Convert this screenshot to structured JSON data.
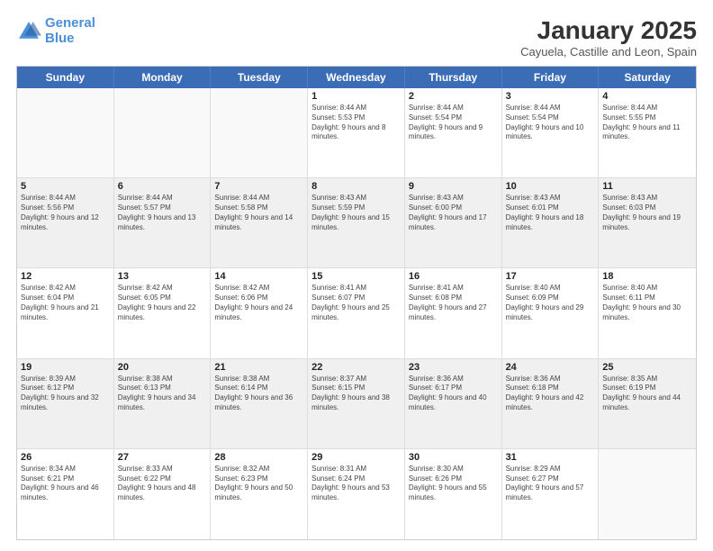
{
  "logo": {
    "line1": "General",
    "line2": "Blue"
  },
  "title": "January 2025",
  "subtitle": "Cayuela, Castille and Leon, Spain",
  "dayHeaders": [
    "Sunday",
    "Monday",
    "Tuesday",
    "Wednesday",
    "Thursday",
    "Friday",
    "Saturday"
  ],
  "rows": [
    {
      "shaded": false,
      "cells": [
        {
          "day": "",
          "info": ""
        },
        {
          "day": "",
          "info": ""
        },
        {
          "day": "",
          "info": ""
        },
        {
          "day": "1",
          "info": "Sunrise: 8:44 AM\nSunset: 5:53 PM\nDaylight: 9 hours and 8 minutes."
        },
        {
          "day": "2",
          "info": "Sunrise: 8:44 AM\nSunset: 5:54 PM\nDaylight: 9 hours and 9 minutes."
        },
        {
          "day": "3",
          "info": "Sunrise: 8:44 AM\nSunset: 5:54 PM\nDaylight: 9 hours and 10 minutes."
        },
        {
          "day": "4",
          "info": "Sunrise: 8:44 AM\nSunset: 5:55 PM\nDaylight: 9 hours and 11 minutes."
        }
      ]
    },
    {
      "shaded": true,
      "cells": [
        {
          "day": "5",
          "info": "Sunrise: 8:44 AM\nSunset: 5:56 PM\nDaylight: 9 hours and 12 minutes."
        },
        {
          "day": "6",
          "info": "Sunrise: 8:44 AM\nSunset: 5:57 PM\nDaylight: 9 hours and 13 minutes."
        },
        {
          "day": "7",
          "info": "Sunrise: 8:44 AM\nSunset: 5:58 PM\nDaylight: 9 hours and 14 minutes."
        },
        {
          "day": "8",
          "info": "Sunrise: 8:43 AM\nSunset: 5:59 PM\nDaylight: 9 hours and 15 minutes."
        },
        {
          "day": "9",
          "info": "Sunrise: 8:43 AM\nSunset: 6:00 PM\nDaylight: 9 hours and 17 minutes."
        },
        {
          "day": "10",
          "info": "Sunrise: 8:43 AM\nSunset: 6:01 PM\nDaylight: 9 hours and 18 minutes."
        },
        {
          "day": "11",
          "info": "Sunrise: 8:43 AM\nSunset: 6:03 PM\nDaylight: 9 hours and 19 minutes."
        }
      ]
    },
    {
      "shaded": false,
      "cells": [
        {
          "day": "12",
          "info": "Sunrise: 8:42 AM\nSunset: 6:04 PM\nDaylight: 9 hours and 21 minutes."
        },
        {
          "day": "13",
          "info": "Sunrise: 8:42 AM\nSunset: 6:05 PM\nDaylight: 9 hours and 22 minutes."
        },
        {
          "day": "14",
          "info": "Sunrise: 8:42 AM\nSunset: 6:06 PM\nDaylight: 9 hours and 24 minutes."
        },
        {
          "day": "15",
          "info": "Sunrise: 8:41 AM\nSunset: 6:07 PM\nDaylight: 9 hours and 25 minutes."
        },
        {
          "day": "16",
          "info": "Sunrise: 8:41 AM\nSunset: 6:08 PM\nDaylight: 9 hours and 27 minutes."
        },
        {
          "day": "17",
          "info": "Sunrise: 8:40 AM\nSunset: 6:09 PM\nDaylight: 9 hours and 29 minutes."
        },
        {
          "day": "18",
          "info": "Sunrise: 8:40 AM\nSunset: 6:11 PM\nDaylight: 9 hours and 30 minutes."
        }
      ]
    },
    {
      "shaded": true,
      "cells": [
        {
          "day": "19",
          "info": "Sunrise: 8:39 AM\nSunset: 6:12 PM\nDaylight: 9 hours and 32 minutes."
        },
        {
          "day": "20",
          "info": "Sunrise: 8:38 AM\nSunset: 6:13 PM\nDaylight: 9 hours and 34 minutes."
        },
        {
          "day": "21",
          "info": "Sunrise: 8:38 AM\nSunset: 6:14 PM\nDaylight: 9 hours and 36 minutes."
        },
        {
          "day": "22",
          "info": "Sunrise: 8:37 AM\nSunset: 6:15 PM\nDaylight: 9 hours and 38 minutes."
        },
        {
          "day": "23",
          "info": "Sunrise: 8:36 AM\nSunset: 6:17 PM\nDaylight: 9 hours and 40 minutes."
        },
        {
          "day": "24",
          "info": "Sunrise: 8:36 AM\nSunset: 6:18 PM\nDaylight: 9 hours and 42 minutes."
        },
        {
          "day": "25",
          "info": "Sunrise: 8:35 AM\nSunset: 6:19 PM\nDaylight: 9 hours and 44 minutes."
        }
      ]
    },
    {
      "shaded": false,
      "cells": [
        {
          "day": "26",
          "info": "Sunrise: 8:34 AM\nSunset: 6:21 PM\nDaylight: 9 hours and 46 minutes."
        },
        {
          "day": "27",
          "info": "Sunrise: 8:33 AM\nSunset: 6:22 PM\nDaylight: 9 hours and 48 minutes."
        },
        {
          "day": "28",
          "info": "Sunrise: 8:32 AM\nSunset: 6:23 PM\nDaylight: 9 hours and 50 minutes."
        },
        {
          "day": "29",
          "info": "Sunrise: 8:31 AM\nSunset: 6:24 PM\nDaylight: 9 hours and 53 minutes."
        },
        {
          "day": "30",
          "info": "Sunrise: 8:30 AM\nSunset: 6:26 PM\nDaylight: 9 hours and 55 minutes."
        },
        {
          "day": "31",
          "info": "Sunrise: 8:29 AM\nSunset: 6:27 PM\nDaylight: 9 hours and 57 minutes."
        },
        {
          "day": "",
          "info": ""
        }
      ]
    }
  ]
}
